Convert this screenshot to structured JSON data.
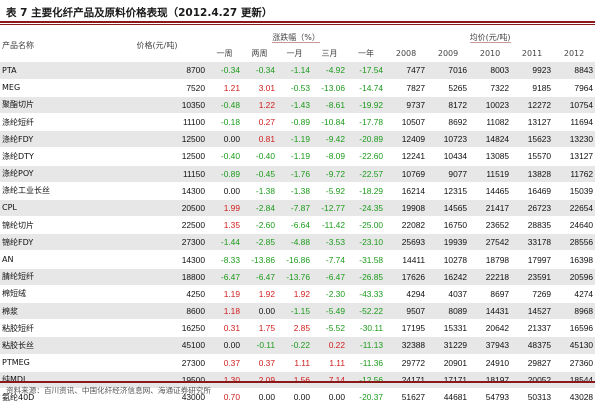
{
  "title": "表 7 主要化纤产品及原料价格表现（2012.4.27 更新）",
  "headers": {
    "product": "产品名称",
    "price": "价格(元/吨)",
    "change_group": "涨跌幅（%）",
    "avg_group": "均价(元/吨)",
    "change_cols": [
      "一周",
      "两周",
      "一月",
      "三月",
      "一年"
    ],
    "year_cols": [
      "2008",
      "2009",
      "2010",
      "2011",
      "2012"
    ]
  },
  "rows": [
    {
      "name": "PTA",
      "price": "8700",
      "changes": [
        "-0.34",
        "-0.34",
        "-1.14",
        "-4.92",
        "-17.54"
      ],
      "avg": [
        "7477",
        "7016",
        "8003",
        "9923",
        "8843"
      ]
    },
    {
      "name": "MEG",
      "price": "7520",
      "changes": [
        "1.21",
        "3.01",
        "-0.53",
        "-13.06",
        "-14.74"
      ],
      "avg": [
        "7827",
        "5265",
        "7322",
        "9185",
        "7964"
      ]
    },
    {
      "name": "聚酯切片",
      "price": "10350",
      "changes": [
        "-0.48",
        "1.22",
        "-1.43",
        "-8.61",
        "-19.92"
      ],
      "avg": [
        "9737",
        "8172",
        "10023",
        "12272",
        "10754"
      ]
    },
    {
      "name": "涤纶短纤",
      "price": "11100",
      "changes": [
        "-0.18",
        "0.27",
        "-0.89",
        "-10.84",
        "-17.78"
      ],
      "avg": [
        "10507",
        "8692",
        "11082",
        "13127",
        "11694"
      ]
    },
    {
      "name": "涤纶FDY",
      "price": "12500",
      "changes": [
        "0.00",
        "0.81",
        "-1.19",
        "-9.42",
        "-20.89"
      ],
      "avg": [
        "12409",
        "10723",
        "14824",
        "15623",
        "13230"
      ]
    },
    {
      "name": "涤纶DTY",
      "price": "12500",
      "changes": [
        "-0.40",
        "-0.40",
        "-1.19",
        "-8.09",
        "-22.60"
      ],
      "avg": [
        "12241",
        "10434",
        "13085",
        "15570",
        "13127"
      ]
    },
    {
      "name": "涤纶POY",
      "price": "11150",
      "changes": [
        "-0.89",
        "-0.45",
        "-1.76",
        "-9.72",
        "-22.57"
      ],
      "avg": [
        "10769",
        "9077",
        "11519",
        "13828",
        "11762"
      ]
    },
    {
      "name": "涤纶工业长丝",
      "price": "14300",
      "changes": [
        "0.00",
        "-1.38",
        "-1.38",
        "-5.92",
        "-18.29"
      ],
      "avg": [
        "16214",
        "12315",
        "14465",
        "16469",
        "15039"
      ]
    },
    {
      "name": "CPL",
      "price": "20500",
      "changes": [
        "1.99",
        "-2.84",
        "-7.87",
        "-12.77",
        "-24.35"
      ],
      "avg": [
        "19908",
        "14565",
        "21417",
        "26723",
        "22654"
      ]
    },
    {
      "name": "锦纶切片",
      "price": "22500",
      "changes": [
        "1.35",
        "-2.60",
        "-6.64",
        "-11.42",
        "-25.00"
      ],
      "avg": [
        "22082",
        "16750",
        "23652",
        "28835",
        "24640"
      ]
    },
    {
      "name": "锦纶FDY",
      "price": "27300",
      "changes": [
        "-1.44",
        "-2.85",
        "-4.88",
        "-3.53",
        "-23.10"
      ],
      "avg": [
        "25693",
        "19939",
        "27542",
        "33178",
        "28556"
      ]
    },
    {
      "name": "AN",
      "price": "14300",
      "changes": [
        "-8.33",
        "-13.86",
        "-16.86",
        "-7.74",
        "-31.58"
      ],
      "avg": [
        "14411",
        "10278",
        "18798",
        "17997",
        "16398"
      ]
    },
    {
      "name": "腈纶短纤",
      "price": "18800",
      "changes": [
        "-6.47",
        "-6.47",
        "-13.76",
        "-6.47",
        "-26.85"
      ],
      "avg": [
        "17626",
        "16242",
        "22218",
        "23591",
        "20596"
      ]
    },
    {
      "name": "棉短绒",
      "price": "4250",
      "changes": [
        "1.19",
        "1.92",
        "1.92",
        "-2.30",
        "-43.33"
      ],
      "avg": [
        "4294",
        "4037",
        "8697",
        "7269",
        "4274"
      ]
    },
    {
      "name": "棉浆",
      "price": "8600",
      "changes": [
        "1.18",
        "0.00",
        "-1.15",
        "-5.49",
        "-52.22"
      ],
      "avg": [
        "9507",
        "8089",
        "14431",
        "14527",
        "8968"
      ]
    },
    {
      "name": "粘胶短纤",
      "price": "16250",
      "changes": [
        "0.31",
        "1.75",
        "2.85",
        "-5.52",
        "-30.11"
      ],
      "avg": [
        "17195",
        "15331",
        "20642",
        "21337",
        "16596"
      ]
    },
    {
      "name": "粘胶长丝",
      "price": "45100",
      "changes": [
        "0.00",
        "-0.11",
        "-0.22",
        "0.22",
        "-11.13"
      ],
      "avg": [
        "32388",
        "31229",
        "37943",
        "48375",
        "45130"
      ]
    },
    {
      "name": "PTMEG",
      "price": "27300",
      "changes": [
        "0.37",
        "0.37",
        "1.11",
        "1.11",
        "-11.36"
      ],
      "avg": [
        "29772",
        "20901",
        "24910",
        "29827",
        "27360"
      ]
    },
    {
      "name": "纯MDI",
      "price": "19500",
      "changes": [
        "1.30",
        "2.09",
        "1.56",
        "7.14",
        "-12.56"
      ],
      "avg": [
        "24171",
        "17171",
        "18197",
        "20052",
        "18544"
      ]
    },
    {
      "name": "氨纶40D",
      "price": "43000",
      "changes": [
        "0.70",
        "0.00",
        "0.00",
        "0.00",
        "-20.37"
      ],
      "avg": [
        "51627",
        "44681",
        "54793",
        "50313",
        "43028"
      ]
    }
  ],
  "colors": {
    "up": "#d11d1d",
    "down": "#1b9b1b",
    "flat": "#111111",
    "rule": "#8a1a1a",
    "shade": "#e7e7e7"
  },
  "source": "资料来源：百川资讯、中国化纤经济信息网、海通证券研究所"
}
